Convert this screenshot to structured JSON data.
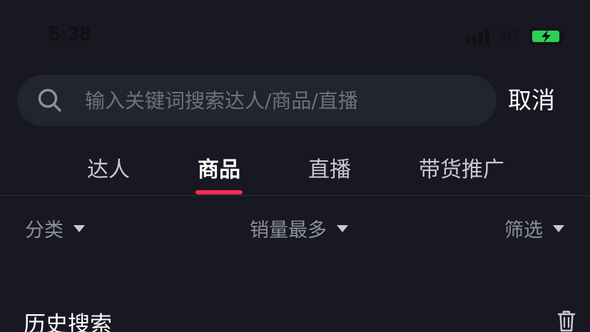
{
  "status_bar": {
    "time": "5:38",
    "network": "4G",
    "icons": [
      "signal-icon",
      "battery-charging-icon"
    ],
    "battery_color": "#2bd155"
  },
  "search": {
    "placeholder": "输入关键词搜索达人/商品/直播",
    "value": "",
    "icon": "search-icon",
    "cancel_label": "取消"
  },
  "tabs": [
    {
      "label": "达人",
      "active": false
    },
    {
      "label": "商品",
      "active": true
    },
    {
      "label": "直播",
      "active": false
    },
    {
      "label": "带货推广",
      "active": false
    }
  ],
  "accent_color": "#fe2c55",
  "filters": {
    "category": "分类",
    "sort": "销量最多",
    "filter": "筛选",
    "icon": "caret-down-icon"
  },
  "history": {
    "title": "历史搜索",
    "icon": "trash-icon"
  }
}
